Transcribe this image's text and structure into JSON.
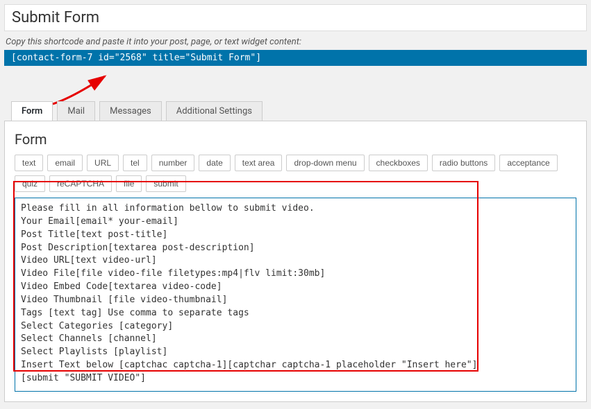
{
  "title_box": {
    "text": "Submit Form"
  },
  "copy_hint": "Copy this shortcode and paste it into your post, page, or text widget content:",
  "shortcode": "[contact-form-7 id=\"2568\" title=\"Submit Form\"]",
  "tabs": [
    {
      "label": "Form",
      "active": true
    },
    {
      "label": "Mail",
      "active": false
    },
    {
      "label": "Messages",
      "active": false
    },
    {
      "label": "Additional Settings",
      "active": false
    }
  ],
  "panel_heading": "Form",
  "tag_buttons": [
    "text",
    "email",
    "URL",
    "tel",
    "number",
    "date",
    "text area",
    "drop-down menu",
    "checkboxes",
    "radio buttons",
    "acceptance",
    "quiz",
    "reCAPTCHA",
    "file",
    "submit"
  ],
  "editor_content": "Please fill in all information bellow to submit video.\nYour Email[email* your-email]\nPost Title[text post-title]\nPost Description[textarea post-description]\nVideo URL[text video-url]\nVideo File[file video-file filetypes:mp4|flv limit:30mb]\nVideo Embed Code[textarea video-code]\nVideo Thumbnail [file video-thumbnail]\nTags [text tag] Use comma to separate tags\nSelect Categories [category]\nSelect Channels [channel]\nSelect Playlists [playlist]\nInsert Text below [captchac captcha-1][captchar captcha-1 placeholder \"Insert here\"]\n[submit \"SUBMIT VIDEO\"]"
}
